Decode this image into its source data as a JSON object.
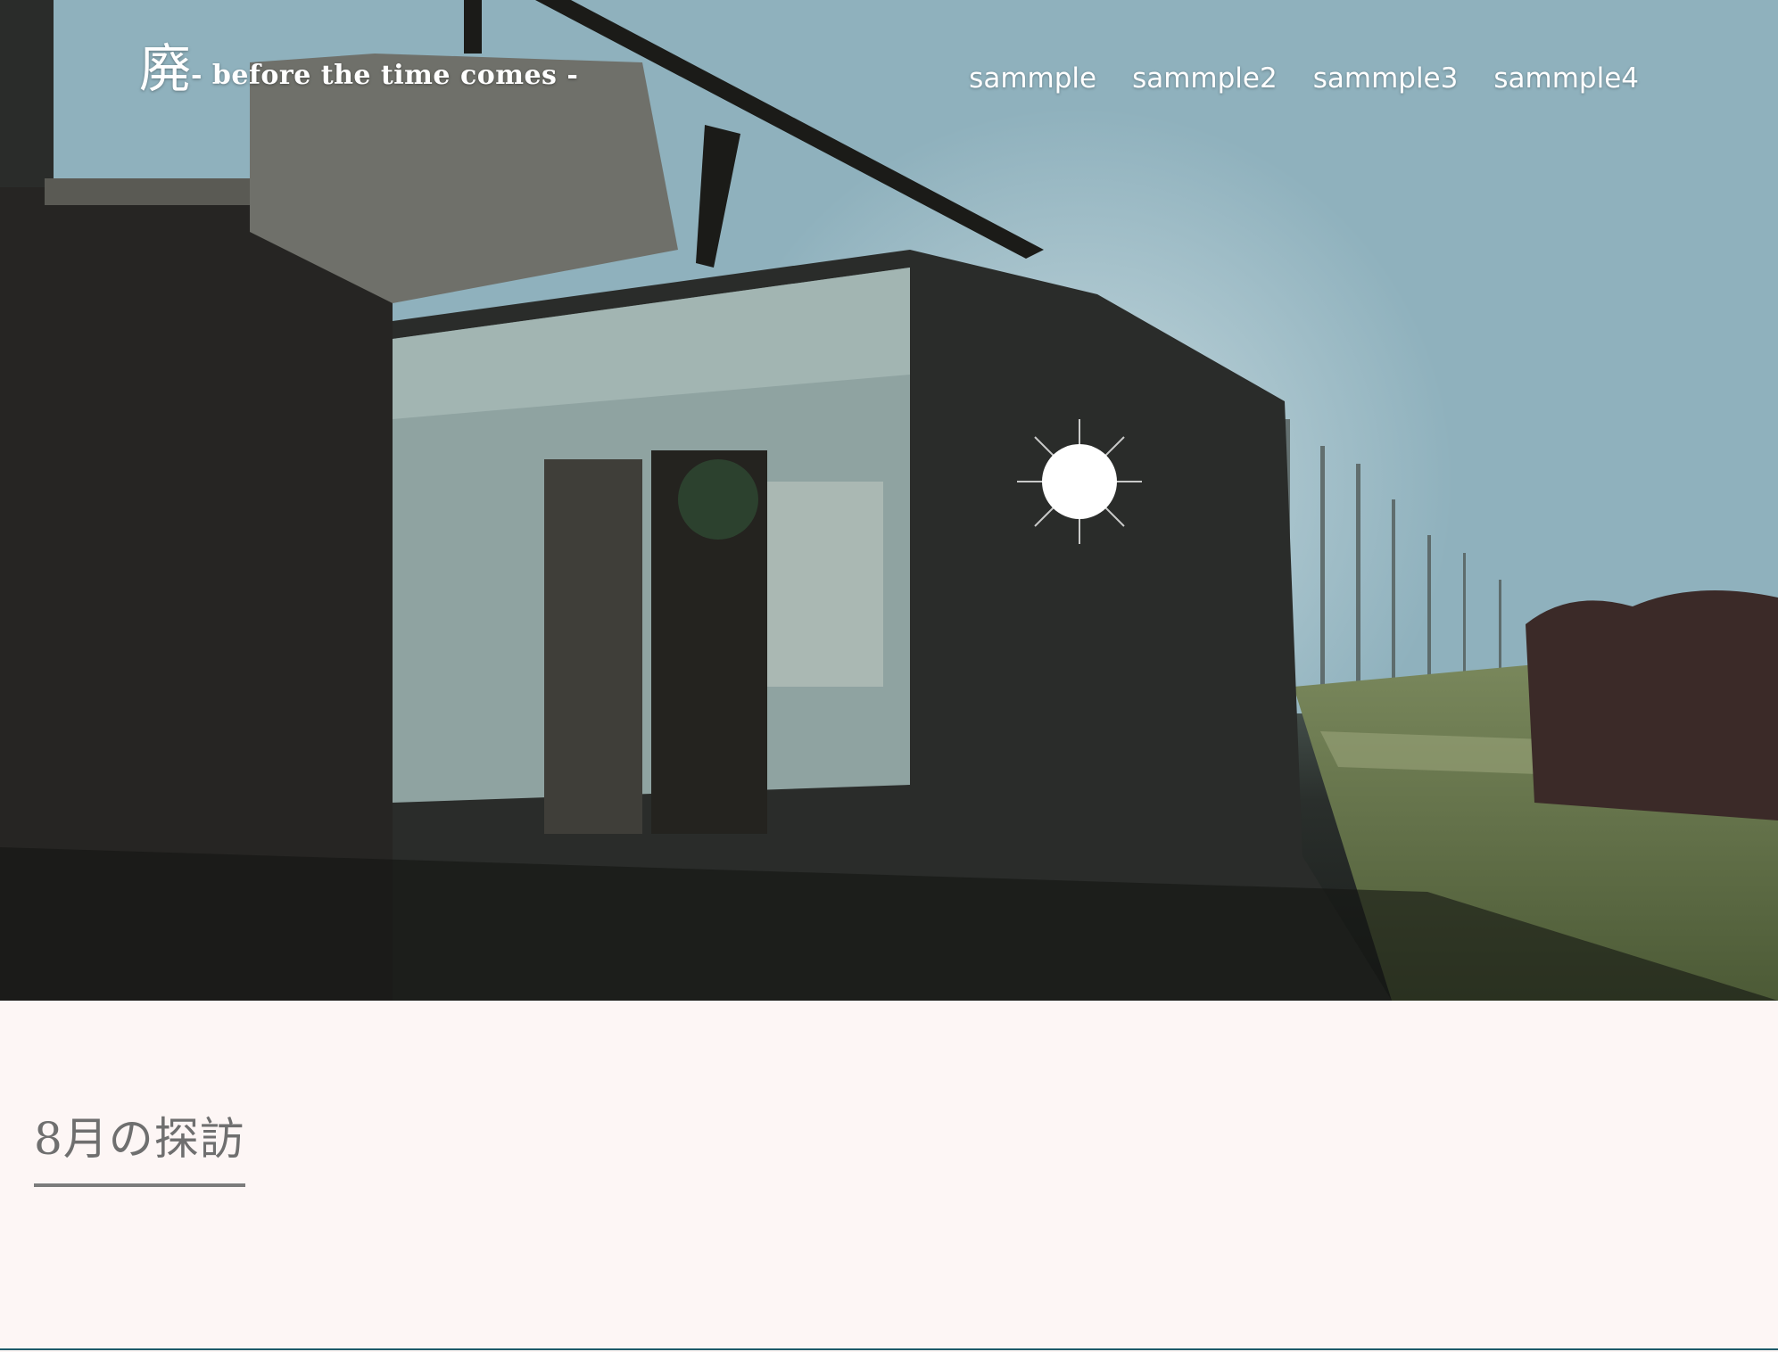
{
  "header": {
    "logo_kanji": "廃",
    "logo_tagline": "- before the time comes -"
  },
  "nav": {
    "items": [
      {
        "label": "sammple"
      },
      {
        "label": "sammple2"
      },
      {
        "label": "sammple3"
      },
      {
        "label": "sammple4"
      }
    ]
  },
  "hero": {
    "image_subject": "ruined abandoned house with sunlight"
  },
  "main": {
    "section_title": "8月の探訪"
  },
  "colors": {
    "content_background": "#fdf6f5",
    "title_text": "#6f6f6f",
    "title_underline": "#7b7b7b",
    "nav_text": "#ffffff"
  }
}
